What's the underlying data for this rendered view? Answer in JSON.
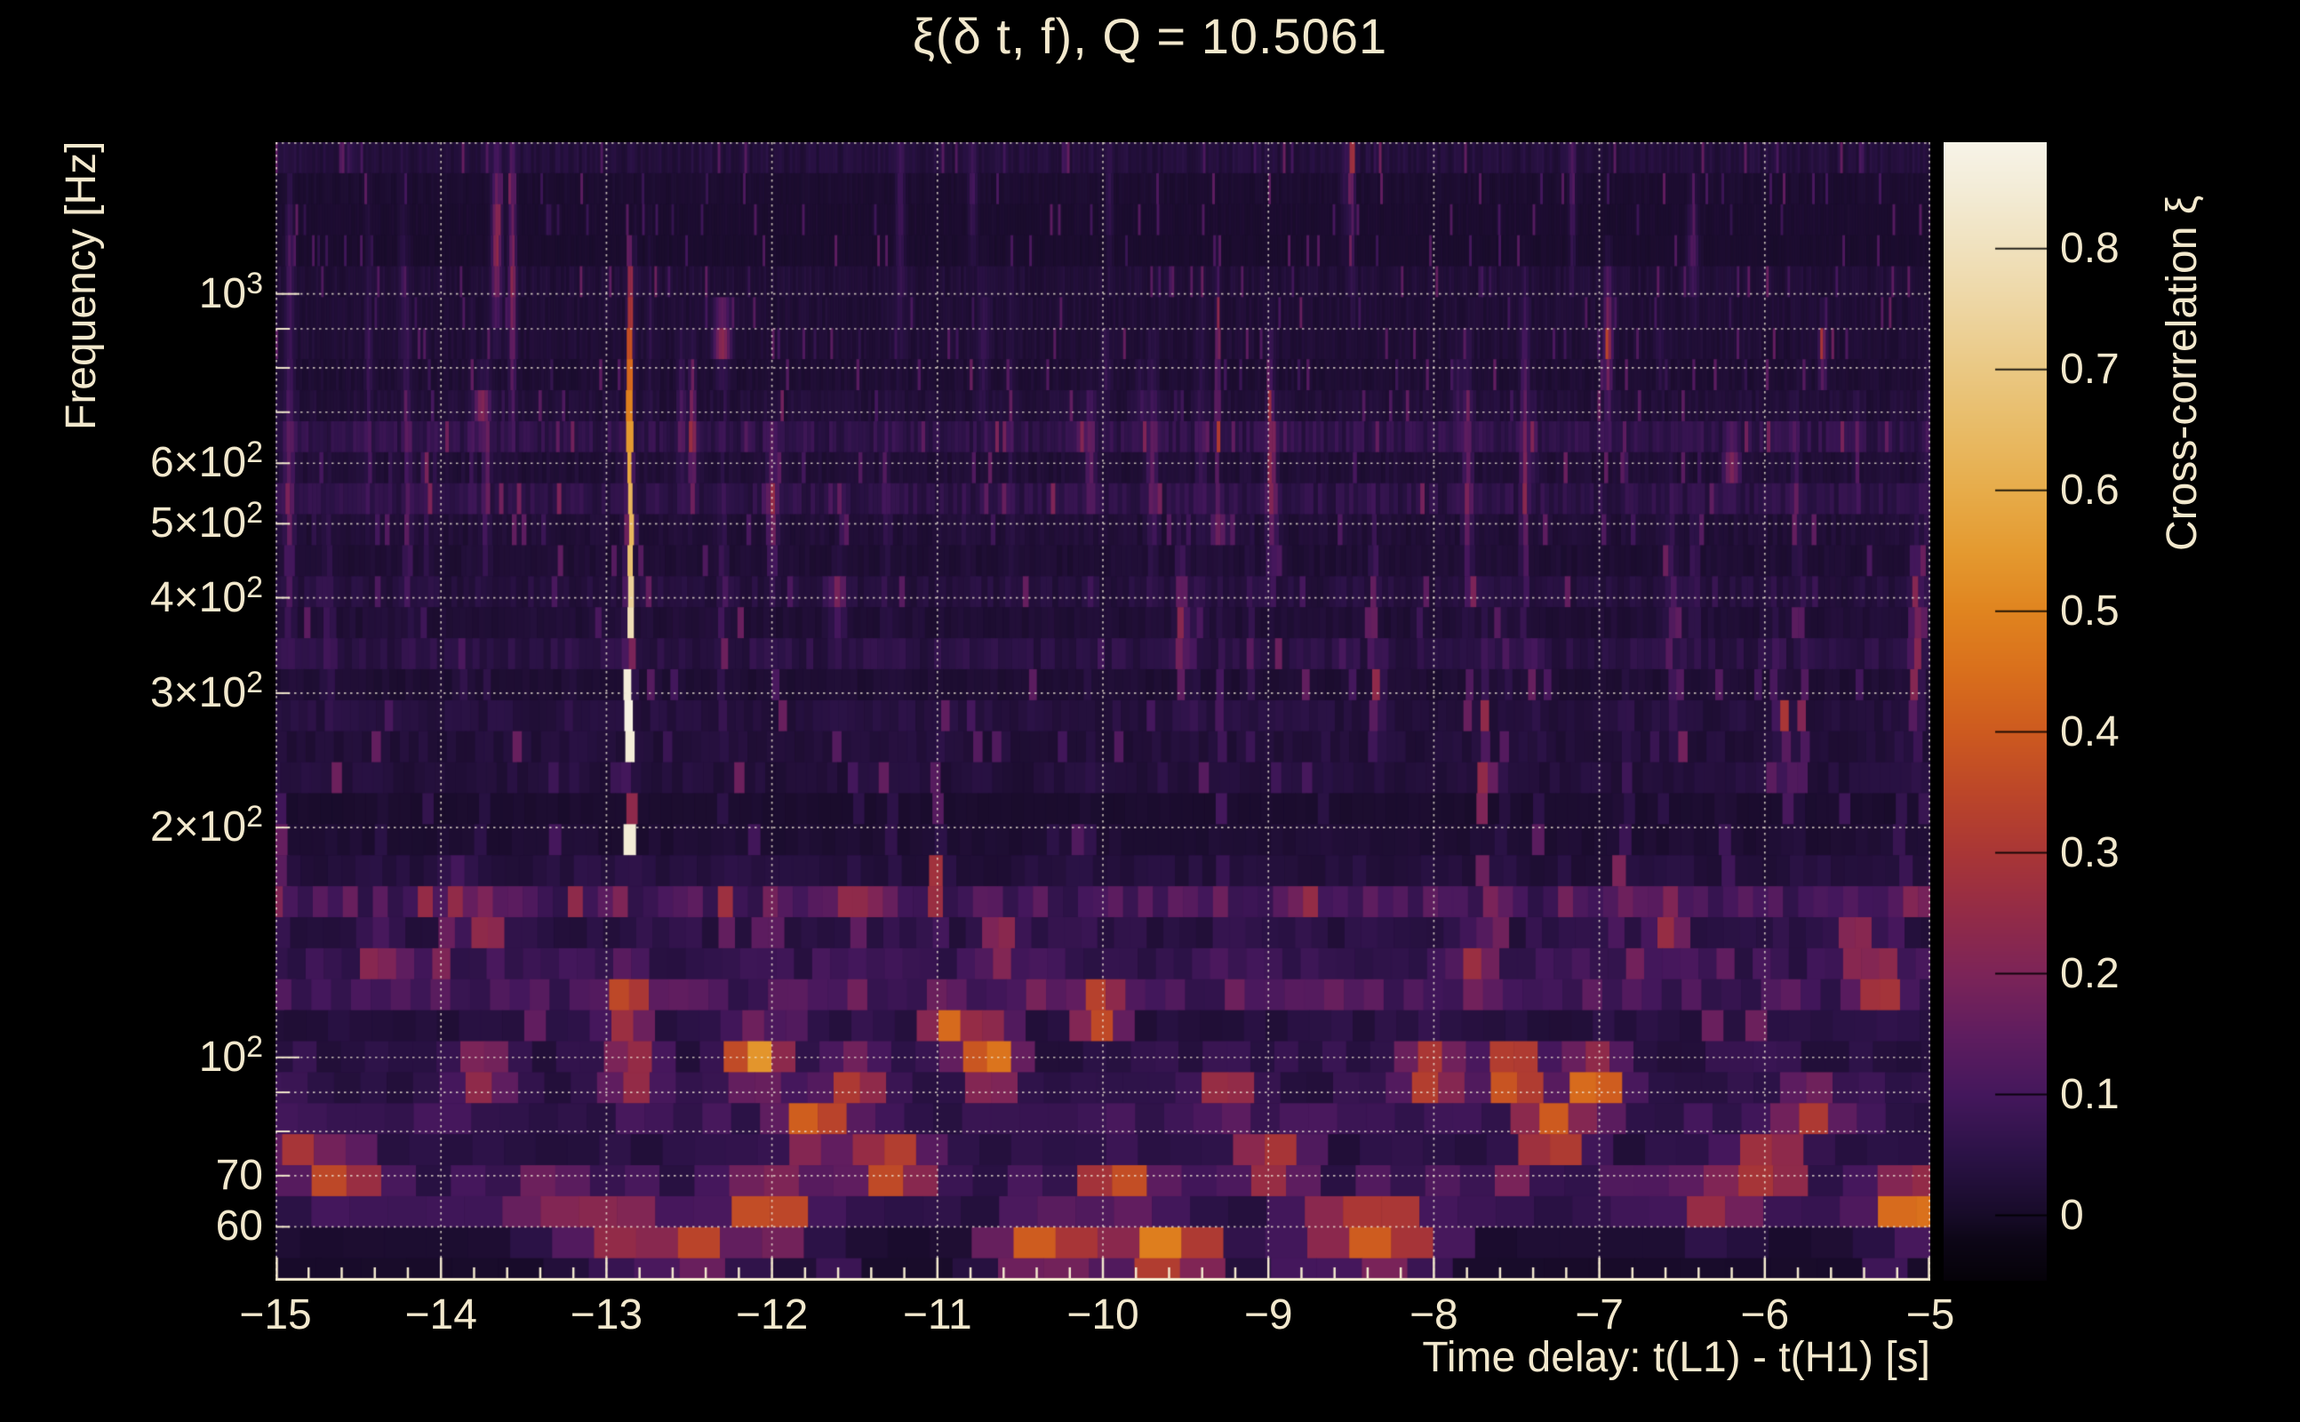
{
  "title": "ξ(δ t, f), Q = 10.5061",
  "axes": {
    "x": {
      "label": "Time delay: t(L1) - t(H1) [s]",
      "min": -15,
      "max": -5,
      "minor_tick_step": 0.2,
      "ticks": [
        {
          "v": -15,
          "label": "−15"
        },
        {
          "v": -14,
          "label": "−14"
        },
        {
          "v": -13,
          "label": "−13"
        },
        {
          "v": -12,
          "label": "−12"
        },
        {
          "v": -11,
          "label": "−11"
        },
        {
          "v": -10,
          "label": "−10"
        },
        {
          "v": -9,
          "label": "−9"
        },
        {
          "v": -8,
          "label": "−8"
        },
        {
          "v": -7,
          "label": "−7"
        },
        {
          "v": -6,
          "label": "−6"
        },
        {
          "v": -5,
          "label": "−5"
        }
      ]
    },
    "y": {
      "label": "Frequency [Hz]",
      "scale": "log",
      "min": 51,
      "max": 1580,
      "tick_labels": [
        {
          "v": 1000,
          "base": "10",
          "exp": "3"
        },
        {
          "v": 600,
          "base": "6×10",
          "exp": "2"
        },
        {
          "v": 500,
          "base": "5×10",
          "exp": "2"
        },
        {
          "v": 400,
          "base": "4×10",
          "exp": "2"
        },
        {
          "v": 300,
          "base": "3×10",
          "exp": "2"
        },
        {
          "v": 200,
          "base": "2×10",
          "exp": "2"
        },
        {
          "v": 100,
          "base": "10",
          "exp": "2"
        },
        {
          "v": 70,
          "base": "70",
          "exp": ""
        },
        {
          "v": 60,
          "base": "60",
          "exp": ""
        }
      ]
    },
    "colorbar": {
      "label": "Cross-correlation ξ",
      "min": -0.054,
      "max": 0.888,
      "ticks": [
        {
          "v": 0.8,
          "label": "0.8"
        },
        {
          "v": 0.7,
          "label": "0.7"
        },
        {
          "v": 0.6,
          "label": "0.6"
        },
        {
          "v": 0.5,
          "label": "0.5"
        },
        {
          "v": 0.4,
          "label": "0.4"
        },
        {
          "v": 0.3,
          "label": "0.3"
        },
        {
          "v": 0.2,
          "label": "0.2"
        },
        {
          "v": 0.1,
          "label": "0.1"
        },
        {
          "v": 0.0,
          "label": "0"
        }
      ]
    }
  },
  "colors": {
    "background": "#000000",
    "text": "#f2e8cd",
    "grid": "#eee6d4",
    "axis": "#f2e8cd",
    "colorbar_tick": "#000000",
    "colormap": [
      {
        "v": -0.054,
        "c": "#050208"
      },
      {
        "v": -0.02,
        "c": "#0d0617"
      },
      {
        "v": 0.0,
        "c": "#170b28"
      },
      {
        "v": 0.05,
        "c": "#2b1246"
      },
      {
        "v": 0.1,
        "c": "#44175c"
      },
      {
        "v": 0.15,
        "c": "#5f1d5f"
      },
      {
        "v": 0.2,
        "c": "#7c2458"
      },
      {
        "v": 0.25,
        "c": "#932b47"
      },
      {
        "v": 0.3,
        "c": "#a93636"
      },
      {
        "v": 0.35,
        "c": "#bc4629"
      },
      {
        "v": 0.4,
        "c": "#cd5a1f"
      },
      {
        "v": 0.45,
        "c": "#d96f1c"
      },
      {
        "v": 0.5,
        "c": "#e0841f"
      },
      {
        "v": 0.55,
        "c": "#e49a30"
      },
      {
        "v": 0.6,
        "c": "#e7ac4a"
      },
      {
        "v": 0.65,
        "c": "#e8bb66"
      },
      {
        "v": 0.7,
        "c": "#eac883"
      },
      {
        "v": 0.75,
        "c": "#edd5a1"
      },
      {
        "v": 0.8,
        "c": "#f0e1bd"
      },
      {
        "v": 0.85,
        "c": "#f3ecd7"
      },
      {
        "v": 0.888,
        "c": "#f7f3e8"
      }
    ]
  },
  "chart_data": {
    "type": "heatmap",
    "title": "ξ(δ t, f), Q = 10.5061",
    "q": 10.5061,
    "xlabel": "Time delay: t(L1) - t(H1) [s]",
    "ylabel": "Frequency [Hz]",
    "zlabel": "Cross-correlation ξ",
    "x_range": [
      -15,
      -5
    ],
    "y_range": [
      51,
      1580
    ],
    "y_scale": "log",
    "z_range": [
      -0.054,
      0.888
    ],
    "grid_time_delays": [
      -15,
      -14,
      -13,
      -12,
      -11,
      -10,
      -9,
      -8,
      -7,
      -6,
      -5
    ],
    "grid_frequencies": [
      60,
      70,
      80,
      90,
      100,
      200,
      300,
      400,
      500,
      600,
      700,
      800,
      900,
      1000
    ],
    "max_correlation": {
      "time_delay_s": -12.86,
      "xi": 0.89,
      "frequency_span_hz": [
        150,
        1120
      ]
    },
    "main_ridge_profile_f_xi": [
      [
        145,
        0.0
      ],
      [
        150,
        0.3
      ],
      [
        160,
        0.55
      ],
      [
        175,
        0.82
      ],
      [
        200,
        0.89
      ],
      [
        250,
        0.885
      ],
      [
        310,
        0.84
      ],
      [
        400,
        0.74
      ],
      [
        500,
        0.65
      ],
      [
        650,
        0.55
      ],
      [
        800,
        0.44
      ],
      [
        950,
        0.3
      ],
      [
        1120,
        0.2
      ],
      [
        1200,
        0.0
      ]
    ],
    "secondary_peaks_tfxi": [
      [
        -14.85,
        75,
        0.3
      ],
      [
        -14.62,
        70,
        0.38
      ],
      [
        -14.3,
        130,
        0.22
      ],
      [
        -13.9,
        160,
        0.25
      ],
      [
        -13.75,
        95,
        0.28
      ],
      [
        -13.72,
        150,
        0.3
      ],
      [
        -13.75,
        700,
        0.22
      ],
      [
        -13.35,
        65,
        0.25
      ],
      [
        -12.95,
        60,
        0.3
      ],
      [
        -12.88,
        118,
        0.4
      ],
      [
        -12.84,
        96,
        0.3
      ],
      [
        -12.48,
        57,
        0.35
      ],
      [
        -12.3,
        880,
        0.24
      ],
      [
        -12.1,
        100,
        0.55
      ],
      [
        -12.02,
        63,
        0.42
      ],
      [
        -11.75,
        82,
        0.45
      ],
      [
        -11.6,
        400,
        0.2
      ],
      [
        -11.5,
        92,
        0.33
      ],
      [
        -11.28,
        72,
        0.45
      ],
      [
        -10.92,
        110,
        0.44
      ],
      [
        -10.68,
        100,
        0.5
      ],
      [
        -10.62,
        140,
        0.3
      ],
      [
        -10.35,
        57,
        0.42
      ],
      [
        -10.02,
        115,
        0.45
      ],
      [
        -9.9,
        68,
        0.4
      ],
      [
        -9.62,
        56,
        0.52
      ],
      [
        -9.3,
        500,
        0.18
      ],
      [
        -9.25,
        90,
        0.3
      ],
      [
        -8.98,
        73,
        0.35
      ],
      [
        -8.6,
        60,
        0.3
      ],
      [
        -8.32,
        59,
        0.45
      ],
      [
        -8.02,
        95,
        0.38
      ],
      [
        -7.75,
        130,
        0.28
      ],
      [
        -7.52,
        95,
        0.5
      ],
      [
        -7.28,
        80,
        0.45
      ],
      [
        -7.03,
        92,
        0.5
      ],
      [
        -6.58,
        150,
        0.28
      ],
      [
        -6.3,
        65,
        0.3
      ],
      [
        -6.2,
        600,
        0.2
      ],
      [
        -5.98,
        72,
        0.4
      ],
      [
        -5.72,
        85,
        0.33
      ],
      [
        -5.45,
        140,
        0.28
      ],
      [
        -5.3,
        125,
        0.38
      ],
      [
        -5.08,
        64,
        0.55
      ]
    ],
    "noise": {
      "seed": 11,
      "background_xi_range": [
        0,
        0.18
      ],
      "streak_xi_range": [
        0.05,
        0.3
      ],
      "n_streaks": 85
    }
  }
}
